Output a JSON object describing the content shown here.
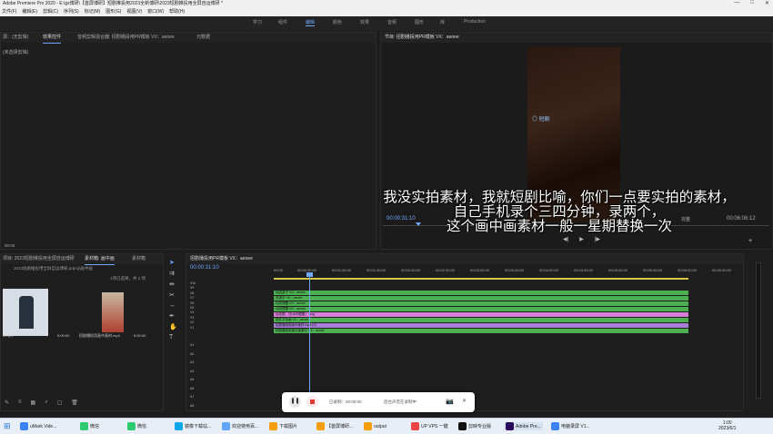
{
  "window": {
    "title": "Adobe Premiere Pro 2020 - E:\\gx博研\\【首屏博研】短剧推投用2023全新博研\\2023短剧推投用全屏自运博研 *",
    "controls": [
      "—",
      "□",
      "✕"
    ]
  },
  "menu": [
    "文件(F)",
    "编辑(E)",
    "剪辑(C)",
    "序列(S)",
    "标记(M)",
    "图形(G)",
    "视图(V)",
    "窗口(W)",
    "帮助(H)"
  ],
  "workspaces": [
    "学习",
    "组件",
    "编辑",
    "颜色",
    "效果",
    "音频",
    "图形",
    "库",
    "Production"
  ],
  "active_workspace": "编辑",
  "source_panel": {
    "tabs": [
      "源：(无剪辑)",
      "效果控件",
      "音频剪辑混合器: 招剧播投用PR模板 VX：aeoee",
      "元数据"
    ],
    "label": "(未选择剪辑)",
    "timecode": "00:00"
  },
  "program_panel": {
    "tab": "节目: 招剧播投用PR模板 VX：aeoee",
    "timecode_in": "00:00:31:10",
    "fit": "完整",
    "timecode_out": "00:06:06:12",
    "overlay_text": "◎ 短剧"
  },
  "subtitle": {
    "line1": "我没实拍素材，我就短剧比喻，你们一点要实拍的素材，",
    "line2": "自己手机录个三四分钟，录两个，",
    "line3": "这个画中画素材一般一星期替换一次"
  },
  "project_panel": {
    "tabs": [
      "项目: 2023短剧推投用全屏自运博研",
      "素材箱: 画中画",
      "素材箱"
    ],
    "path": "2023短剧推投用全屏自运博研.prproj\\画中画",
    "count": "1项已选择，共 2 项",
    "items": [
      {
        "name": "1.mp4",
        "duration": "5:00:00"
      },
      {
        "name": "招剧播投用画中画材.mp4",
        "duration": "5:00:00"
      }
    ]
  },
  "timeline": {
    "tab": "招剧播投用PR模板 VX：aeoee",
    "timecode": "00:00:31:10",
    "ruler": [
      "00:00",
      "00:00:30:00",
      "00:01:00:00",
      "00:01:30:00",
      "00:02:00:00",
      "00:02:30:00",
      "00:03:00:00",
      "00:03:30:00",
      "00:04:00:00",
      "00:04:30:00",
      "00:05:00:00",
      "00:05:30:00",
      "00:06:00:00",
      "00:06:30:00"
    ],
    "video_tracks": [
      "V10",
      "V9",
      "V8",
      "V7",
      "V6",
      "V5",
      "V4",
      "V3",
      "V2",
      "V1"
    ],
    "audio_tracks": [
      "A1",
      "A2",
      "A3",
      "A4",
      "A5",
      "A6",
      "A7",
      "A8"
    ],
    "clips": [
      {
        "label": "动态盒子 VX：aeoee",
        "color": "#4caf50"
      },
      {
        "label": "关键字 VX：aeoee",
        "color": "#4caf50"
      },
      {
        "label": "动态提醒 VX：aeoee",
        "color": "#4caf50"
      },
      {
        "label": "动态提醒 VX：aeoee",
        "color": "#4caf50"
      },
      {
        "label": "动态图 （去水印图集）.png",
        "color": "#d77fd6"
      },
      {
        "label": "插件字动画 VX：aeoee",
        "color": "#4caf50"
      },
      {
        "label": "招剧播投用画中画材.mp4 [V]",
        "color": "#a67fd6"
      },
      {
        "label": "招剧播投用画中画素材 VX：aeoee",
        "color": "#4caf50"
      }
    ]
  },
  "recorder": {
    "time": "已录制：00:00:00",
    "text": "后台声音在录制中"
  },
  "taskbar": {
    "items": [
      "uMark Vide...",
      "微信",
      "微信",
      "镜像下载站...",
      "欢迎使用百...",
      "下载图片",
      "【首屏博研...",
      "output",
      "UP VPS 一键",
      "剪映专业版",
      "Adobe Pre...",
      "电脑录屏 V1..."
    ],
    "time": "1:00",
    "date": "2023/6/1"
  },
  "colors": {
    "accent": "#6fa8ff",
    "clip_green": "#4caf50",
    "clip_pink": "#d77fd6",
    "rec_red": "#e53935"
  }
}
